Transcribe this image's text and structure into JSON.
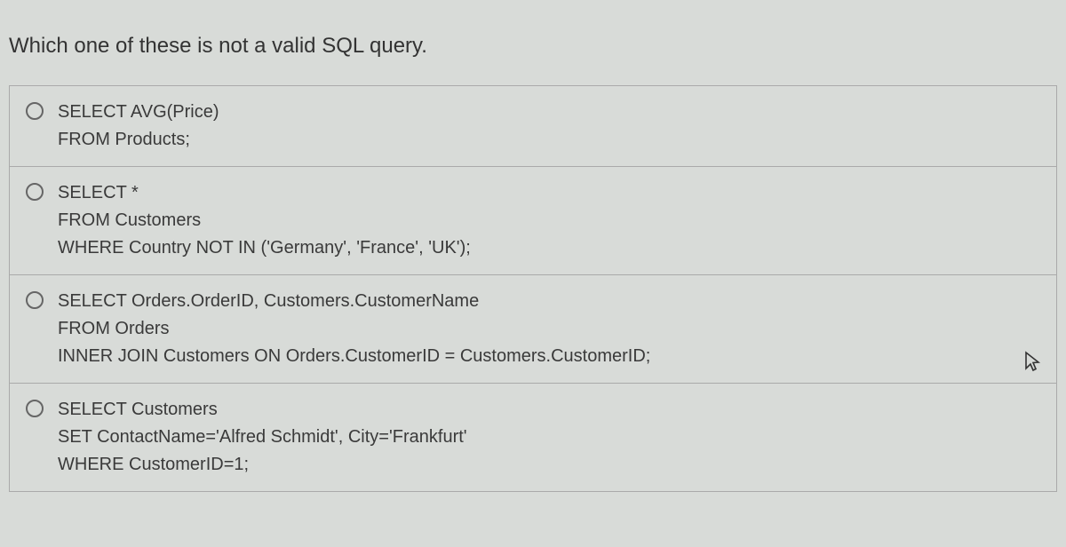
{
  "question": "Which one of these is not a valid SQL query.",
  "options": [
    {
      "line1": "SELECT AVG(Price)",
      "line2": "FROM Products;",
      "line3": ""
    },
    {
      "line1": "SELECT *",
      "line2": "FROM Customers",
      "line3": "WHERE Country NOT IN ('Germany', 'France', 'UK');"
    },
    {
      "line1": "SELECT Orders.OrderID, Customers.CustomerName",
      "line2": "FROM Orders",
      "line3": "INNER JOIN Customers ON Orders.CustomerID = Customers.CustomerID;"
    },
    {
      "line1": "SELECT Customers",
      "line2": "SET ContactName='Alfred Schmidt', City='Frankfurt'",
      "line3": "WHERE CustomerID=1;"
    }
  ]
}
